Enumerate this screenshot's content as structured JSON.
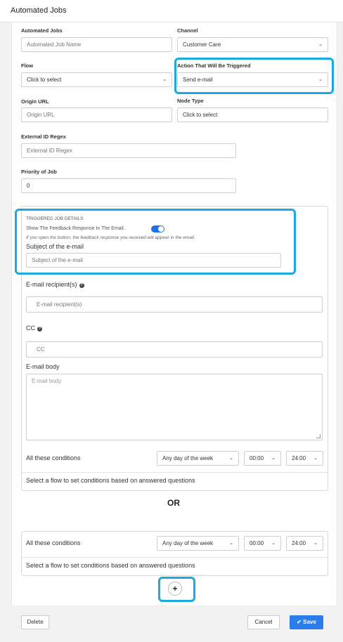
{
  "header": {
    "title": "Automated Jobs"
  },
  "form": {
    "automated_jobs": {
      "label": "Automated Jobs",
      "placeholder": "Automated Job Name"
    },
    "channel": {
      "label": "Channel",
      "value": "Customer Care"
    },
    "flow": {
      "label": "Flow",
      "value": "Click to select"
    },
    "action": {
      "label": "Action That Will Be Triggered",
      "value": "Send e-mail"
    },
    "origin_url": {
      "label": "Origin URL",
      "placeholder": "Origin URL"
    },
    "node_type": {
      "label": "Node Type",
      "value": "Click to select"
    },
    "external_id": {
      "label": "External ID Regex",
      "placeholder": "External ID Regex"
    },
    "priority": {
      "label": "Priority of Job",
      "value": "0"
    }
  },
  "triggered": {
    "section_title": "TRIGGERED JOB DETAILS",
    "feedback_label": "Show The Feedback Response In The Email.",
    "feedback_on": true,
    "feedback_hint": "If you open the button, the feedback response you received will appear in the email.",
    "subject_label": "Subject of the e-mail",
    "subject_placeholder": "Subject of the e-mail",
    "recipient_label": "E-mail recipient(s)",
    "recipient_placeholder": "E-mail recipient(s)",
    "cc_label": "CC",
    "cc_placeholder": "CC",
    "body_label": "E-mail body",
    "body_placeholder": "E-mail body"
  },
  "conditions": [
    {
      "label": "All these conditions",
      "day": "Any day of the week",
      "start": "00:00",
      "end": "24:00",
      "hint": "Select a flow to set conditions based on answered questions"
    },
    {
      "label": "All these conditions",
      "day": "Any day of the week",
      "start": "00:00",
      "end": "24:00",
      "hint": "Select a flow to set conditions based on answered questions"
    }
  ],
  "or_label": "OR",
  "add_symbol": "+",
  "footer": {
    "delete": "Delete",
    "cancel": "Cancel",
    "save": "Save"
  },
  "icons": {
    "chevron": "chevron-down-icon",
    "help": "question-circle-icon",
    "check": "check-icon"
  },
  "colors": {
    "highlight": "#1ba9e1",
    "primary": "#2b7de9"
  }
}
